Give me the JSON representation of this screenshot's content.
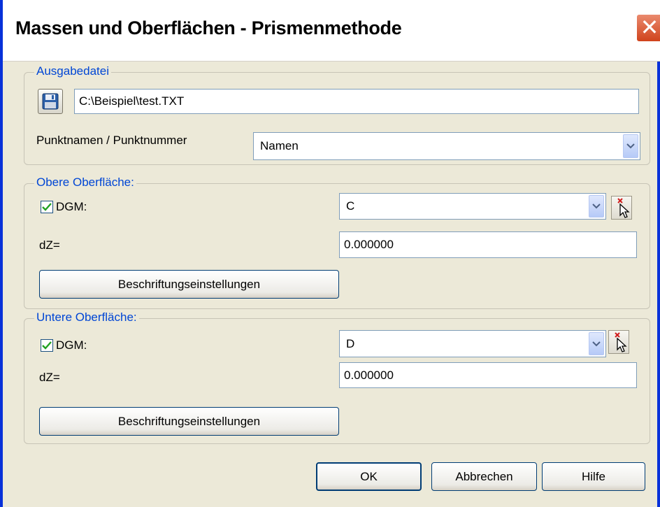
{
  "dialog": {
    "title": "Massen und Oberflächen - Prismenmethode",
    "close_glyph": "✕"
  },
  "ausgabe": {
    "legend": "Ausgabedatei",
    "file_path": "C:\\Beispiel\\test.TXT",
    "punkt_label": "Punktnamen / Punktnummer",
    "punkt_value": "Namen"
  },
  "obere": {
    "legend": "Obere Oberfläche:",
    "dgm_checked": true,
    "dgm_label": "DGM:",
    "dgm_value": "C",
    "dz_label": "dZ=",
    "dz_value": "0.000000",
    "button_label": "Beschriftungseinstellungen"
  },
  "untere": {
    "legend": "Untere Oberfläche:",
    "dgm_checked": true,
    "dgm_label": "DGM:",
    "dgm_value": "D",
    "dz_label": "dZ=",
    "dz_value": "0.000000",
    "button_label": "Beschriftungseinstellungen"
  },
  "footer": {
    "ok_label": "OK",
    "cancel_label": "Abbrechen",
    "help_label": "Hilfe"
  },
  "colors": {
    "dialog_bg": "#ece9d8",
    "legend_blue": "#0046d5",
    "close_red": "#d0431c",
    "frame_blue": "#0831d9"
  },
  "icons": {
    "close": "close-icon",
    "save": "floppy-disk-icon",
    "dropdown": "chevron-down-icon",
    "pick": "pick-from-drawing-icon",
    "check": "checkmark-icon"
  }
}
